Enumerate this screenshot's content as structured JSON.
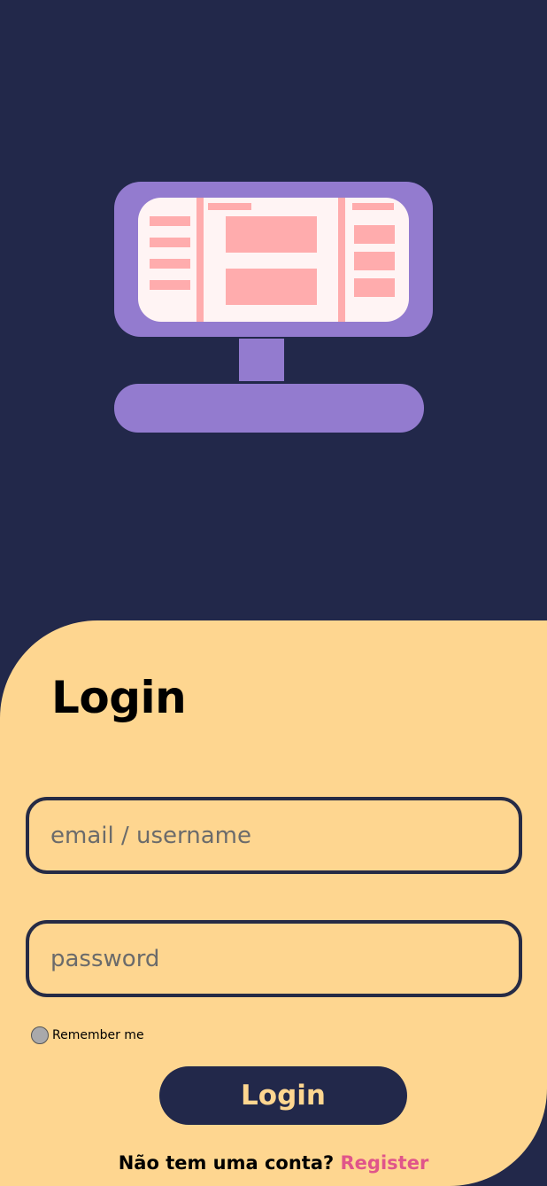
{
  "colors": {
    "background": "#22284a",
    "panel": "#fed690",
    "monitor": "#937bcf",
    "screen": "#fff4f4",
    "screen_blocks": "#ffacad",
    "button_bg": "#22284a",
    "button_text": "#fed690",
    "link": "#e0558a"
  },
  "illustration": {
    "icon": "computer-monitor-icon"
  },
  "form": {
    "title": "Login",
    "email_placeholder": "email / username",
    "email_value": "",
    "password_placeholder": "password",
    "password_value": "",
    "remember_label": "Remember me",
    "remember_checked": false,
    "submit_label": "Login"
  },
  "footer": {
    "prompt": "Não tem uma conta?",
    "link_label": "Register"
  }
}
